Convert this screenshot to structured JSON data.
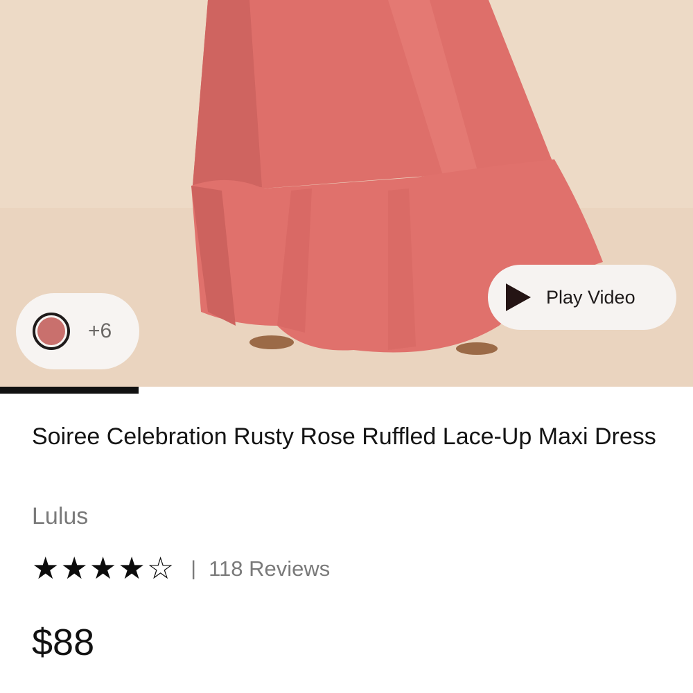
{
  "hero": {
    "colors": {
      "background": "#eedcc9",
      "dress": "#df6f6a",
      "dress_shadow": "#c85d59"
    },
    "swatches": {
      "selected_color": "#c9706d",
      "more_label": "+6"
    },
    "video": {
      "play_label": "Play Video",
      "icon": "play-icon"
    },
    "gallery_progress": 0.2
  },
  "product": {
    "title": "Soiree Celebration Rusty Rose Ruffled Lace-Up Maxi Dress",
    "brand": "Lulus",
    "rating": {
      "value": 4,
      "max": 5,
      "divider": "|",
      "reviews_label": "118 Reviews"
    },
    "price": "$88"
  }
}
